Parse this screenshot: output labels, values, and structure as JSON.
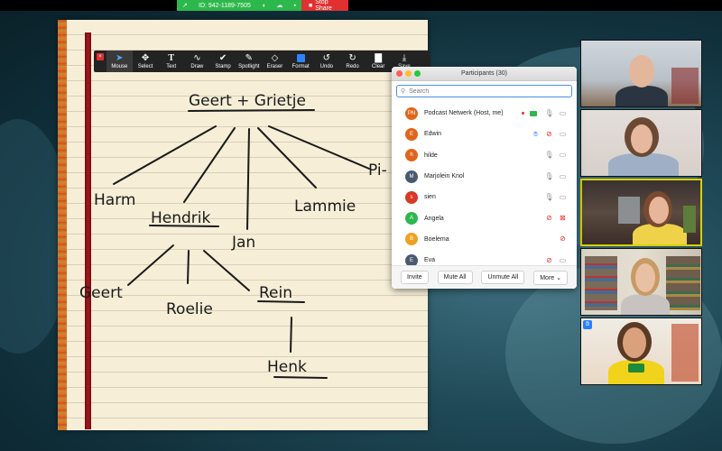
{
  "share_bar": {
    "meeting_id": "ID: 942-1189-7505",
    "stop_share_label": "Stop Share"
  },
  "annotation_toolbar": {
    "tools": [
      {
        "label": "Mouse",
        "icon": "mouse-pointer-icon",
        "active": true
      },
      {
        "label": "Select",
        "icon": "select-move-icon"
      },
      {
        "label": "Text",
        "icon": "text-icon"
      },
      {
        "label": "Draw",
        "icon": "draw-squiggle-icon"
      },
      {
        "label": "Stamp",
        "icon": "stamp-check-icon"
      },
      {
        "label": "Spotlight",
        "icon": "spotlight-icon"
      },
      {
        "label": "Eraser",
        "icon": "eraser-icon"
      },
      {
        "label": "Format",
        "icon": "format-color-icon"
      },
      {
        "label": "Undo",
        "icon": "undo-icon"
      },
      {
        "label": "Redo",
        "icon": "redo-icon"
      },
      {
        "label": "Clear",
        "icon": "trash-icon"
      },
      {
        "label": "Save",
        "icon": "save-icon"
      }
    ]
  },
  "participants_panel": {
    "title": "Participants (30)",
    "search_placeholder": "Search",
    "participants": [
      {
        "initials": "PN",
        "name": "Podcast Netwerk (Host, me)",
        "color": "#e0651c",
        "muted": false,
        "video_off": false
      },
      {
        "initials": "E",
        "name": "Edwin",
        "color": "#e0651c",
        "hand_raised": true,
        "muted": true,
        "video_off": false
      },
      {
        "initials": "h",
        "name": "hilde",
        "color": "#e0651c",
        "muted": false,
        "video_off": false
      },
      {
        "initials": "M",
        "name": "Marjolein Knol",
        "color": "#4a5a6e",
        "muted": false,
        "video_off": false
      },
      {
        "initials": "s",
        "name": "sien",
        "color": "#d73a25",
        "muted": false,
        "video_off": false
      },
      {
        "initials": "A",
        "name": "Angela",
        "color": "#2db84b",
        "muted": true,
        "video_off": true
      },
      {
        "initials": "B",
        "name": "Boelema",
        "color": "#f0a020",
        "muted": true,
        "video_off": false
      },
      {
        "initials": "E",
        "name": "Eva",
        "color": "#4a5a6e",
        "muted": true,
        "video_off": false
      }
    ],
    "buttons": {
      "invite": "Invite",
      "mute_all": "Mute All",
      "unmute_all": "Unmute All",
      "more": "More ⌄"
    }
  },
  "notebook": {
    "names": {
      "root": "Geert + Grietje",
      "child_1": "Harm",
      "child_2": "Hendrik",
      "child_3": "Jan",
      "child_4": "Lammie",
      "child_5": "Pi-",
      "grandchild_1": "Geert",
      "grandchild_2": "Roelie",
      "grandchild_3": "Rein",
      "great_grandchild": "Henk"
    }
  },
  "colors": {
    "share_green": "#2db84b",
    "stop_red": "#e0302f",
    "active_speaker": "#d8d000",
    "search_focus": "#4a90e2"
  }
}
